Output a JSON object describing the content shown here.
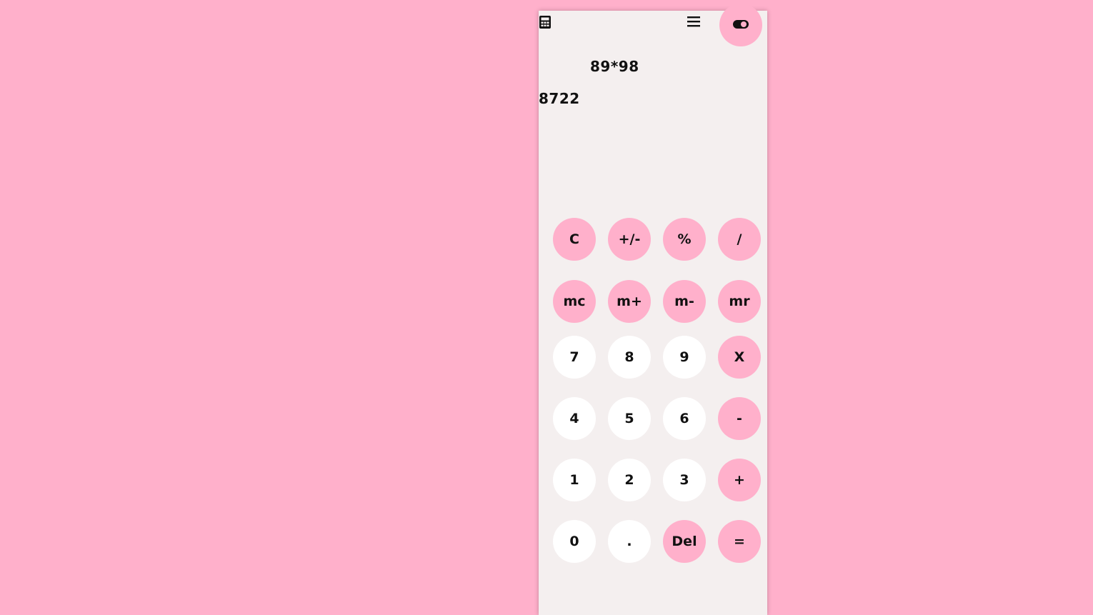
{
  "display": {
    "expression": "89*98",
    "result": "8722"
  },
  "icons": {
    "app": "calculator-icon",
    "menu": "hamburger-menu-icon",
    "theme": "toggle-icon"
  },
  "colors": {
    "background": "#ffb0cb",
    "panel": "#f4efef",
    "accent_key": "#ffb0cb",
    "number_key": "#ffffff"
  },
  "keys": {
    "clear": "C",
    "sign": "+/-",
    "percent": "%",
    "divide": "/",
    "mc": "mc",
    "mplus": "m+",
    "mminus": "m-",
    "mr": "mr",
    "seven": "7",
    "eight": "8",
    "nine": "9",
    "multiply": "X",
    "four": "4",
    "five": "5",
    "six": "6",
    "minus": "-",
    "one": "1",
    "two": "2",
    "three": "3",
    "plus": "+",
    "zero": "0",
    "decimal": ".",
    "del": "Del",
    "equals": "="
  }
}
